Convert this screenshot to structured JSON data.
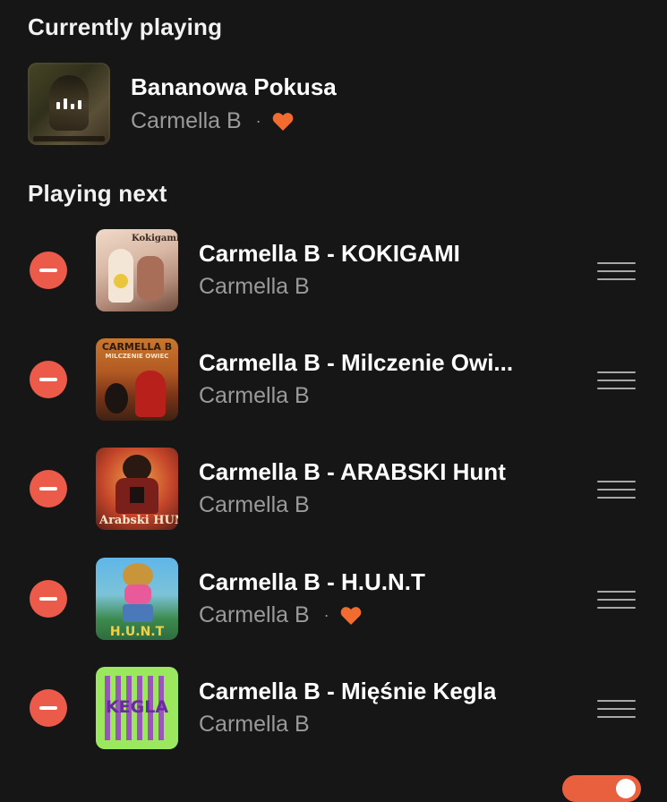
{
  "sections": {
    "current_title": "Currently playing",
    "next_title": "Playing next"
  },
  "now_playing": {
    "title": "Bananowa Pokusa",
    "artist": "Carmella B",
    "separator": "·",
    "liked": true,
    "playing_icon": "equalizer-icon"
  },
  "queue": [
    {
      "title": "Carmella B - KOKIGAMI",
      "artist": "Carmella B",
      "liked": false,
      "art_text": "Kokigami"
    },
    {
      "title": "Carmella B - Milczenie Owi...",
      "artist": "Carmella B",
      "liked": false,
      "art_text": "CARMELLA B",
      "art_text2": "MILCZENIE OWIEC"
    },
    {
      "title": "Carmella B - ARABSKI Hunt",
      "artist": "Carmella B",
      "liked": false,
      "art_text": "Arabski HUNT"
    },
    {
      "title": "Carmella B - H.U.N.T",
      "artist": "Carmella B",
      "liked": true,
      "separator": "·",
      "art_text": "H.U.N.T"
    },
    {
      "title": "Carmella B - Mięśnie Kegla",
      "artist": "Carmella B",
      "liked": false,
      "art_text": "KEGLA"
    }
  ],
  "colors": {
    "background": "#161616",
    "accent_heart": "#f26b2f",
    "remove_button": "#ec5a4a",
    "secondary_text": "#9a9a9a"
  }
}
